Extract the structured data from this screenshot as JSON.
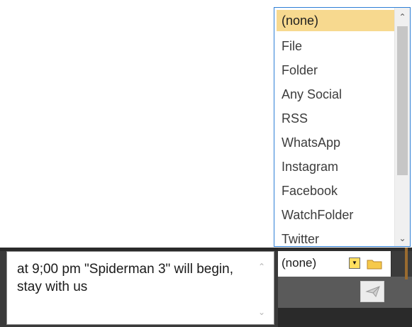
{
  "dropdown": {
    "items": [
      {
        "label": "(none)",
        "selected": true
      },
      {
        "label": "File"
      },
      {
        "label": "Folder"
      },
      {
        "label": "Any Social"
      },
      {
        "label": "RSS"
      },
      {
        "label": "WhatsApp"
      },
      {
        "label": "Instagram"
      },
      {
        "label": "Facebook"
      },
      {
        "label": "WatchFolder"
      },
      {
        "label": "Twitter"
      }
    ],
    "scroll_up_icon": "chevron-up-icon",
    "scroll_down_icon": "chevron-down-icon"
  },
  "message": {
    "text": "at 9;00 pm \"Spiderman 3\" will begin, stay with us"
  },
  "combo": {
    "value": "(none)",
    "arrow_icon": "dropdown-arrow-icon",
    "folder_icon": "folder-icon"
  },
  "colors": {
    "selection": "#f7d98f",
    "border_accent": "#2e7fd6",
    "folder": "#f6c94a"
  }
}
